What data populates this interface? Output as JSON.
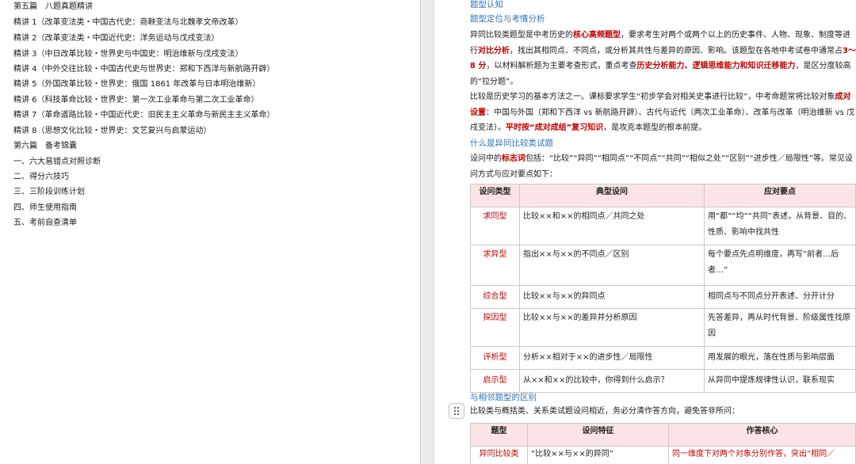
{
  "left_page": {
    "lines": [
      "第五篇　八题真题精讲",
      "精讲 1（改革变法类・中国古代史：商鞅变法与北魏孝文帝改革）",
      "精讲 2（改革变法类・中国近代史：洋务运动与戊戌变法）",
      "精讲 3（中日改革比较・世界史与中国史：明治维新与戊戌变法）",
      "精讲 4（中外交往比较・中国古代史与世界史：郑和下西洋与新航路开辟）",
      "精讲 5（外国改革比较・世界史：俄国 1861 年改革与日本明治维新）",
      "精讲 6（科技革命比较・世界史：第一次工业革命与第二次工业革命）",
      "精讲 7（革命道路比较・中国近代史：旧民主主义革命与新民主主义革命）",
      "精讲 8（思想文化比较・世界史：文艺复兴与启蒙运动）",
      "第六篇　备考锦囊",
      "一、六大易错点对照诊断",
      "二、得分六技巧",
      "三、三阶段训练计划",
      "四、师生使用指南",
      "五、考前自查清单"
    ]
  },
  "right_page": {
    "heading_1": "题型认知",
    "heading_2": "题型定位与考情分析",
    "para1": {
      "s1": "异同比较类题型是中考历史的",
      "s2": "核心高频题型",
      "s3": "，要求考生对两个或两个以上的历史事件、人物、现象、制度等进行",
      "s4": "对比分析",
      "s5": "，找出其相同点、不同点，或分析其共性与差异的原因、影响。该题型在各地中考试卷中通常占",
      "s6": "3～8 分",
      "s7": "，以材料解析题为主要考查形式，重点考查",
      "s8": "历史分析能力、逻辑思维能力和知识迁移能力",
      "s9": "，是区分度较高的“拉分题”。"
    },
    "para2": {
      "s1": "比较是历史学习的基本方法之一。课标要求学生“初步学会对相关史事进行比较”，中考命题常将比较对象",
      "s2": "成对设置",
      "s3": "：中国与外国（郑和下西洋 vs 新航路开辟）、古代与近代（两次工业革命）、改革与改革（明治维新 vs 戊戌变法）。",
      "s4": "平时按“成对成组”复习知识",
      "s5": "，是攻克本题型的根本前提。"
    },
    "heading_3": "什么是异同比较类试题",
    "para3": {
      "s1": "设问中的",
      "s2": "标志词",
      "s3": "包括：“比较”“异同”“相同点”“不同点”“共同”“相似之处”“区别”“进步性／局限性”等。常见设问方式与应对要点如下："
    },
    "table1": {
      "headers": [
        "设问类型",
        "典型设问",
        "应对要点"
      ],
      "rows": [
        [
          "求同型",
          "比较××和××的相同点／共同之处",
          "用“都”“均”“共同”表述，从背景、目的、性质、影响中找共性"
        ],
        [
          "求异型",
          "指出××与××的不同点／区别",
          "每个要点先点明维度，再写“前者…后者…”"
        ],
        [
          "综合型",
          "比较××与××的异同点",
          "相同点与不同点分开表述、分开计分"
        ],
        [
          "探因型",
          "比较××与××的差异并分析原因",
          "先答差异，再从时代背景、阶级属性找原因"
        ],
        [
          "评析型",
          "分析××相对于××的进步性／局限性",
          "用发展的眼光，落在性质与影响层面"
        ],
        [
          "启示型",
          "从××和××的比较中，你得到什么启示？",
          "从异同中提炼规律性认识，联系现实"
        ]
      ]
    },
    "heading_4": "与相邻题型的区别",
    "para4": "比较类与概括类、关系类试题设问相近，务必分清作答方向，避免答非所问：",
    "table2": {
      "headers": [
        "题型",
        "设问特征",
        "作答核心"
      ],
      "rows": [
        [
          "异同比较类",
          "“比较××与××的异同”",
          "同一维度下对两个对象分别作答，突出“相同／"
        ]
      ]
    }
  },
  "colors": {
    "accent_red": "#c00000",
    "heading_blue": "#2e74b5",
    "table_header_bg": "#fce4e6"
  },
  "icons": {
    "drag_handle": "drag-handle-icon"
  }
}
